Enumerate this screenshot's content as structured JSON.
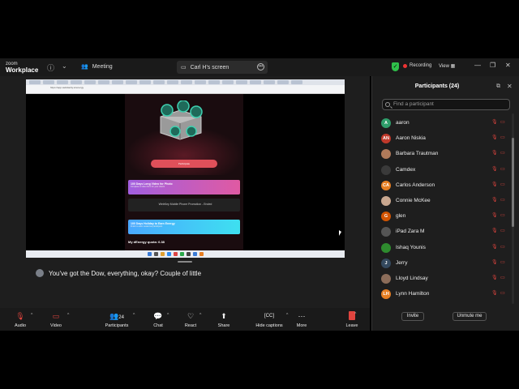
{
  "app": {
    "logo_line1": "zoom",
    "logo_line2": "Workplace",
    "meeting_label": "Meeting",
    "screen_label": "Carl H's screen",
    "recording_label": "Recording",
    "view_label": "View"
  },
  "shared_screen": {
    "url": "https://app.webdacity.io/energy",
    "participate_label": "Participate",
    "card1_title": "100 Days Long Video for Photo",
    "card1_sub": "Complete a video from for your clients",
    "card2_title": "WebKey Mobile Phone Promotion - Ended",
    "card3_title": "100 Days Holiday to Earn Energy",
    "card3_sub": "Finish to earn reward as participant",
    "quota": "My dEnergy quota: 6.38"
  },
  "caption": {
    "text": "You've got the Dow, everything, okay? Couple of little"
  },
  "participants": {
    "title": "Participants (24)",
    "search_placeholder": "Find a participant",
    "list": [
      {
        "initials": "A",
        "name": "aaron",
        "color": "#2f9e6b"
      },
      {
        "initials": "AN",
        "name": "Aaron Niskia",
        "color": "#c0392b"
      },
      {
        "initials": "",
        "name": "Barbara Trautman",
        "color": "#b07a5a"
      },
      {
        "initials": "",
        "name": "Camdex",
        "color": "#3a3a3a"
      },
      {
        "initials": "CA",
        "name": "Carlos Anderson",
        "color": "#e67e22"
      },
      {
        "initials": "",
        "name": "Connie McKee",
        "color": "#c9a78f"
      },
      {
        "initials": "G",
        "name": "glen",
        "color": "#d35400"
      },
      {
        "initials": "",
        "name": "iPad Zara M",
        "color": "#555555"
      },
      {
        "initials": "",
        "name": "Ishaq Younis",
        "color": "#2e8b2e"
      },
      {
        "initials": "J",
        "name": "Jerry",
        "color": "#34495e"
      },
      {
        "initials": "",
        "name": "Lloyd Lindsay",
        "color": "#8c6d5a"
      },
      {
        "initials": "LH",
        "name": "Lynn Hamilton",
        "color": "#e67e22"
      }
    ],
    "invite_label": "Invite",
    "unmute_label": "Unmute me"
  },
  "toolbar": {
    "audio_label": "Audio",
    "video_label": "Video",
    "participants_count": "24",
    "participants_label": "Participants",
    "chat_label": "Chat",
    "react_label": "React",
    "share_label": "Share",
    "captions_label": "Hide captions",
    "more_label": "More",
    "leave_label": "Leave"
  },
  "colors": {
    "accent_red": "#e0443e",
    "panel_bg": "#1e1e1e",
    "toolbar_bg": "#1a1a1a"
  }
}
